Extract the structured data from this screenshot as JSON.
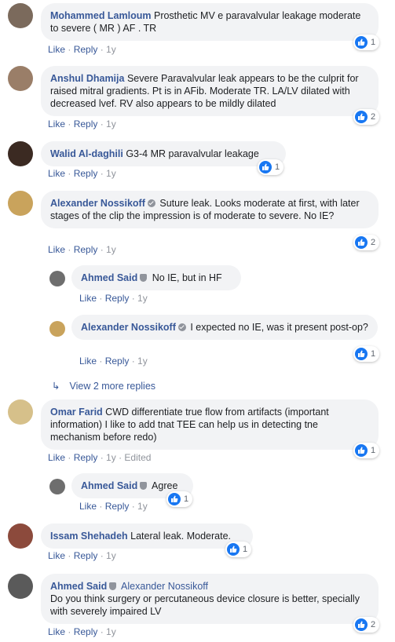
{
  "comments": [
    {
      "name": "Mohammed Lamloum",
      "text": "Prosthetic MV e paravalvular leakage moderate to severe ( MR ) AF . TR",
      "like": "Like",
      "reply": "Reply",
      "time": "1y",
      "reactions": "1"
    },
    {
      "name": "Anshul Dhamija",
      "text": "Severe Paravalvular leak appears to be the culprit for raised mitral gradients. Pt is in AFib. Moderate TR. LA/LV dilated with decreased lvef. RV also appears to be mildly dilated",
      "like": "Like",
      "reply": "Reply",
      "time": "1y",
      "reactions": "2"
    },
    {
      "name": "Walid Al-daghili",
      "text": "G3-4 MR paravalvular leakage",
      "like": "Like",
      "reply": "Reply",
      "time": "1y",
      "reactions": "1"
    },
    {
      "name": "Alexander Nossikoff",
      "text": "Suture leak. Looks moderate at first, with later stages of the clip the impression is of moderate to severe. No IE?",
      "like": "Like",
      "reply": "Reply",
      "time": "1y",
      "reactions": "2"
    },
    {
      "name": "Ahmed Said",
      "text": "No IE, but in HF",
      "like": "Like",
      "reply": "Reply",
      "time": "1y"
    },
    {
      "name": "Alexander Nossikoff",
      "text": "I expected no IE, was it present post-op?",
      "like": "Like",
      "reply": "Reply",
      "time": "1y",
      "reactions": "1"
    },
    {
      "name": "Omar Farid",
      "text": "CWD differentiate true flow from artifacts (important information) I like to add tnat TEE can help us in detecting tne mechanism before redo)",
      "like": "Like",
      "reply": "Reply",
      "time": "1y",
      "edited": "Edited",
      "reactions": "1"
    },
    {
      "name": "Ahmed Said",
      "text": "Agree",
      "like": "Like",
      "reply": "Reply",
      "time": "1y",
      "reactions": "1"
    },
    {
      "name": "Issam Shehadeh",
      "text": "Lateral leak. Moderate.",
      "like": "Like",
      "reply": "Reply",
      "time": "1y",
      "reactions": "1"
    },
    {
      "name": "Ahmed Said",
      "tag": "Alexander Nossikoff",
      "text": "Do you think surgery or percutaneous device closure is better, specially with severely impaired LV",
      "like": "Like",
      "reply": "Reply",
      "time": "1y",
      "reactions": "2"
    }
  ],
  "view_more": "View 2 more replies",
  "colors": {
    "link": "#385898",
    "bubble": "#f2f3f5",
    "like_blue": "#1877f2",
    "meta": "#90949c"
  }
}
